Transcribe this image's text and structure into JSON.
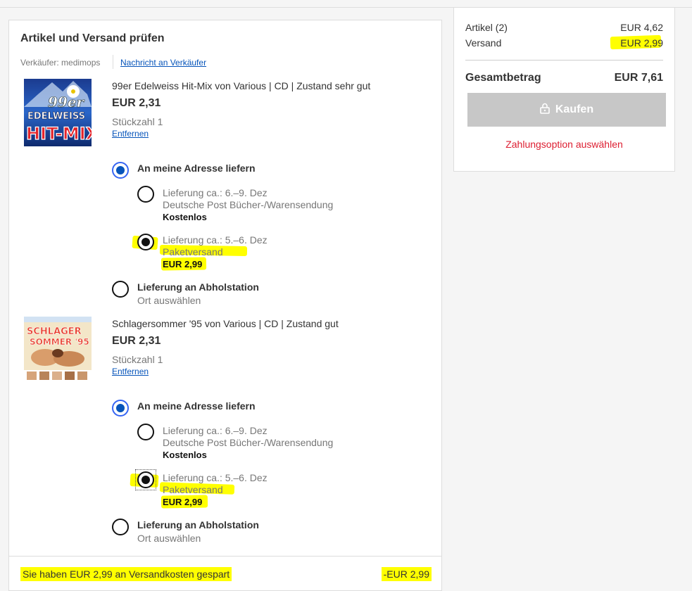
{
  "checkout": {
    "title": "Artikel und Versand prüfen",
    "seller_label": "Verkäufer:",
    "seller_name": "medimops",
    "message_link": "Nachricht an Verkäufer",
    "items": [
      {
        "thumb_lines": [
          "99er",
          "EDELWEISS",
          "HIT-MIX"
        ],
        "title": "99er Edelweiss Hit-Mix von Various | CD | Zustand sehr gut",
        "price": "EUR 2,31",
        "qty": "Stückzahl 1",
        "remove": "Entfernen",
        "ship_home": "An meine Adresse liefern",
        "opt1_date": "Lieferung ca.: 6.–9. Dez",
        "opt1_carrier": "Deutsche Post Bücher-/Warensendung",
        "opt1_price": "Kostenlos",
        "opt2_date": "Lieferung ca.: 5.–6. Dez",
        "opt2_carrier": "Paketversand",
        "opt2_price": "EUR 2,99",
        "pickup": "Lieferung an Abholstation",
        "pickup_sub": "Ort auswählen"
      },
      {
        "thumb_lines": [
          "SCHLAGER",
          "SOMMER '95"
        ],
        "title": "Schlagersommer '95 von Various | CD | Zustand gut",
        "price": "EUR 2,31",
        "qty": "Stückzahl 1",
        "remove": "Entfernen",
        "ship_home": "An meine Adresse liefern",
        "opt1_date": "Lieferung ca.: 6.–9. Dez",
        "opt1_carrier": "Deutsche Post Bücher-/Warensendung",
        "opt1_price": "Kostenlos",
        "opt2_date": "Lieferung ca.: 5.–6. Dez",
        "opt2_carrier": "Paketversand",
        "opt2_price": "EUR 2,99",
        "pickup": "Lieferung an Abholstation",
        "pickup_sub": "Ort auswählen"
      }
    ],
    "saved_text": "Sie haben EUR 2,99 an Versandkosten gespart",
    "saved_amount": "-EUR 2,99"
  },
  "summary": {
    "items_label": "Artikel (2)",
    "items_value": "EUR 4,62",
    "shipping_label": "Versand",
    "shipping_value": "EUR 2,99",
    "total_label": "Gesamtbetrag",
    "total_value": "EUR 7,61",
    "buy_label": "Kaufen",
    "pay_option": "Zahlungsoption auswählen"
  },
  "colors": {
    "highlight": "#ffff00",
    "link": "#0654ba",
    "error": "#dd1e31",
    "disabled_button": "#c7c7c7"
  },
  "icons": [
    "lock-icon"
  ]
}
